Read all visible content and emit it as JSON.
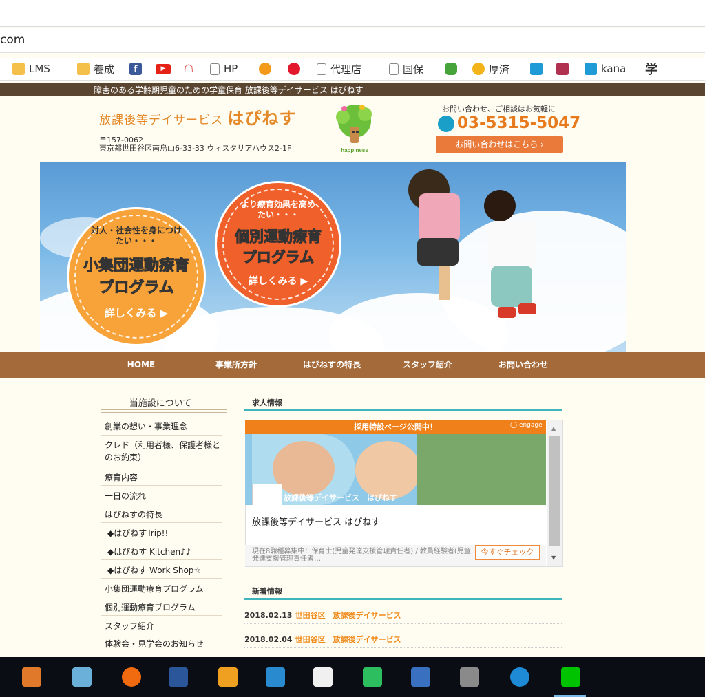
{
  "browser": {
    "url": "com",
    "bookmarks": [
      {
        "label": "LMS",
        "icon": "folder-icon"
      },
      {
        "label": "養成",
        "icon": "folder-icon"
      },
      {
        "label": "",
        "icon": "facebook-icon"
      },
      {
        "label": "",
        "icon": "youtube-icon"
      },
      {
        "label": "",
        "icon": "site-icon"
      },
      {
        "label": "HP",
        "icon": "page-icon"
      },
      {
        "label": "",
        "icon": "site-icon"
      },
      {
        "label": "",
        "icon": "site-icon"
      },
      {
        "label": "代理店",
        "icon": "page-icon"
      },
      {
        "label": "国保",
        "icon": "page-icon"
      },
      {
        "label": "",
        "icon": "database-icon"
      },
      {
        "label": "厚済",
        "icon": "site-icon"
      },
      {
        "label": "",
        "icon": "site-icon"
      },
      {
        "label": "",
        "icon": "site-icon"
      },
      {
        "label": "kana",
        "icon": "site-icon"
      },
      {
        "label": "学",
        "icon": ""
      }
    ]
  },
  "site": {
    "topbar": "障害のある学齢期児童のための学童保育 放課後等デイサービス はぴねす",
    "title_prefix": "放課後等デイサービス",
    "title_main": "はぴねす",
    "postal_code": "〒157-0062",
    "address": "東京都世田谷区南烏山6-33-33 ウィスタリアハウス2-1F",
    "logo_text": "happiness",
    "contact_note": "お問い合わせ、ご相談はお気軽に",
    "phone": "03-5315-5047",
    "contact_button": "お問い合わせはこちら ›",
    "hero": {
      "badge1": {
        "sub": "対人・社会性を身につけたい・・・",
        "title1": "小集団運動療育",
        "title2": "プログラム",
        "link": "詳しくみる ▶"
      },
      "badge2": {
        "sub": "より療育効果を高めたい・・・",
        "title1": "個別運動療育",
        "title2": "プログラム",
        "link": "詳しくみる ▶"
      }
    },
    "nav": [
      "HOME",
      "事業所方針",
      "はぴねすの特長",
      "スタッフ紹介",
      "お問い合わせ"
    ],
    "sidebar": {
      "heading": "当施設について",
      "items": [
        "創業の想い・事業理念",
        "クレド（利用者様、保護者様とのお約束）",
        "療育内容",
        "一日の流れ",
        "はぴねすの特長",
        "◆はぴねすTrip!!",
        "◆はぴねす Kitchen♪♪",
        "◆はぴねす Work Shop☆",
        "小集団運動療育プログラム",
        "個別運動療育プログラム",
        "スタッフ紹介",
        "体験会・見学会のお知らせ"
      ]
    },
    "jobs": {
      "heading": "求人情報",
      "banner": "採用特設ページ公開中！",
      "engage": "engage",
      "photo_caption": "放課後等デイサービス　はぴねす",
      "office": "放課後等デイサービス はぴねす",
      "summary": "現在8職種募集中：保育士(児童発達支援管理責任者) / 教員経験者(児童発達支援管理責任者…",
      "check_button": "今すぐチェック"
    },
    "news": {
      "heading": "新着情報",
      "items": [
        {
          "date": "2018.02.13",
          "category": "世田谷区　放課後デイサービス"
        },
        {
          "date": "2018.02.04",
          "category": "世田谷区　放課後デイサービス"
        }
      ]
    }
  },
  "colors": {
    "brand_orange": "#e48a2a",
    "nav_brown": "#a46a3a",
    "topbar_brown": "#5a4530",
    "teal": "#3fb5bd"
  }
}
